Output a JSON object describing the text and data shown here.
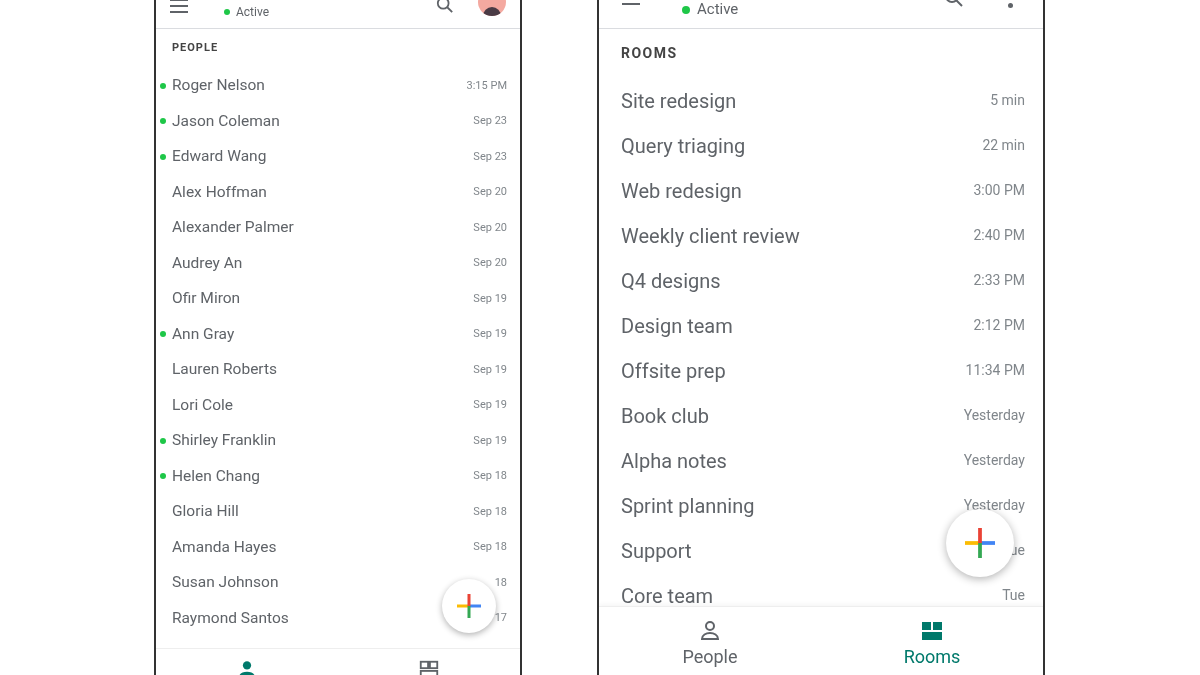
{
  "left_screen": {
    "header": {
      "status": "Active"
    },
    "section_label": "PEOPLE",
    "people": [
      {
        "name": "Roger Nelson",
        "time": "3:15 PM",
        "online": true
      },
      {
        "name": "Jason Coleman",
        "time": "Sep 23",
        "online": true
      },
      {
        "name": "Edward Wang",
        "time": "Sep 23",
        "online": true
      },
      {
        "name": "Alex Hoffman",
        "time": "Sep 20",
        "online": false
      },
      {
        "name": "Alexander Palmer",
        "time": "Sep 20",
        "online": false
      },
      {
        "name": "Audrey An",
        "time": "Sep 20",
        "online": false
      },
      {
        "name": "Ofir Miron",
        "time": "Sep 19",
        "online": false
      },
      {
        "name": "Ann Gray",
        "time": "Sep 19",
        "online": true
      },
      {
        "name": "Lauren Roberts",
        "time": "Sep 19",
        "online": false
      },
      {
        "name": "Lori Cole",
        "time": "Sep 19",
        "online": false
      },
      {
        "name": "Shirley Franklin",
        "time": "Sep 19",
        "online": true
      },
      {
        "name": "Helen Chang",
        "time": "Sep 18",
        "online": true
      },
      {
        "name": "Gloria Hill",
        "time": "Sep 18",
        "online": false
      },
      {
        "name": "Amanda Hayes",
        "time": "Sep 18",
        "online": false
      },
      {
        "name": "Susan Johnson",
        "time": "18",
        "online": false
      },
      {
        "name": "Raymond Santos",
        "time": "17",
        "online": false
      }
    ],
    "nav_tabs": [
      {
        "kind": "people",
        "selected": true
      },
      {
        "kind": "rooms",
        "selected": false
      }
    ]
  },
  "right_screen": {
    "header": {
      "status": "Active"
    },
    "section_label": "ROOMS",
    "rooms": [
      {
        "name": "Site redesign",
        "time": "5 min"
      },
      {
        "name": "Query triaging",
        "time": "22 min"
      },
      {
        "name": "Web redesign",
        "time": "3:00 PM"
      },
      {
        "name": "Weekly client review",
        "time": "2:40 PM"
      },
      {
        "name": "Q4 designs",
        "time": "2:33 PM"
      },
      {
        "name": "Design team",
        "time": "2:12 PM"
      },
      {
        "name": "Offsite prep",
        "time": "11:34 PM"
      },
      {
        "name": "Book club",
        "time": "Yesterday"
      },
      {
        "name": "Alpha notes",
        "time": "Yesterday"
      },
      {
        "name": "Sprint planning",
        "time": "Yesterday"
      },
      {
        "name": "Support",
        "time": "ue"
      },
      {
        "name": "Core team",
        "time": "Tue"
      }
    ],
    "nav_tabs": [
      {
        "kind": "people",
        "label": "People",
        "selected": false
      },
      {
        "kind": "rooms",
        "label": "Rooms",
        "selected": true
      }
    ]
  }
}
